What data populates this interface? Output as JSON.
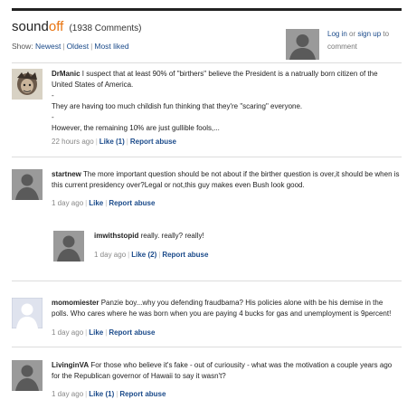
{
  "header": {
    "brand_sound": "sound",
    "brand_off": "off",
    "comment_count": "(1938 Comments)",
    "show_label": "Show:",
    "sort_newest": "Newest",
    "sort_oldest": "Oldest",
    "sort_most_liked": "Most liked",
    "login_link": "Log in",
    "or_text": "or",
    "signup_link": "sign up",
    "to_comment_text": "to comment"
  },
  "comments": [
    {
      "author": "DrManic",
      "lines": [
        "I suspect that at least 90% of \"birthers\" believe the President is a natrually born citizen of the United States of America.",
        "-",
        "They are having too much childish fun thinking that they're \"scaring\" everyone.",
        "-",
        "However, the remaining 10% are just gullible fools,..."
      ],
      "time": "22 hours ago",
      "like": "Like (1)",
      "report": "Report abuse"
    },
    {
      "author": "startnew",
      "text": "The more important question should be not about if the birther question is over,it should be when is this current presidency over?Legal or not,this guy makes even Bush look good.",
      "time": "1 day ago",
      "like": "Like",
      "report": "Report abuse"
    },
    {
      "author": "imwithstopid",
      "text": "really. really? really!",
      "time": "1 day ago",
      "like": "Like (2)",
      "report": "Report abuse"
    },
    {
      "author": "momomiester",
      "text": "Panzie boy...why you defending fraudbama? His policies alone with be his demise in the polls. Who cares where he was born when you are paying 4 bucks for gas and unemployment is 9percent!",
      "time": "1 day ago",
      "like": "Like",
      "report": "Report abuse"
    },
    {
      "author": "LivinginVA",
      "text": "For those who believe it's fake - out of curiousity - what was the motivation a couple years ago for the Republican governor of Hawaii to say it wasn't?",
      "time": "1 day ago",
      "like": "Like (1)",
      "report": "Report abuse"
    }
  ]
}
